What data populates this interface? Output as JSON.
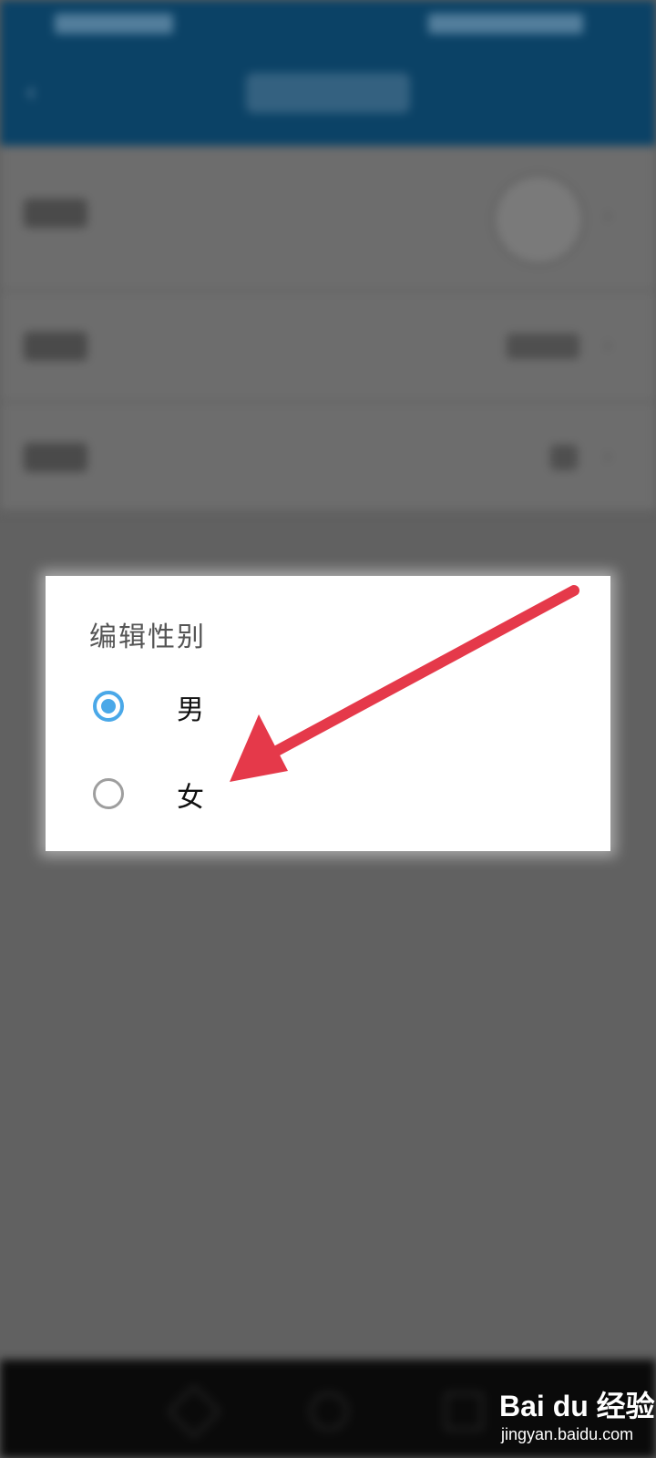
{
  "dialog": {
    "title": "编辑性别",
    "options": [
      {
        "label": "男",
        "selected": true
      },
      {
        "label": "女",
        "selected": false
      }
    ]
  },
  "colors": {
    "header": "#0b4266",
    "radio_checked": "#4aa8e8",
    "radio_unchecked": "#9e9e9e",
    "arrow": "#e5394a",
    "overlay": "#616161"
  },
  "watermark": {
    "brand": "Bai du 经验",
    "url": "jingyan.baidu.com"
  },
  "icons": {
    "back": "back-arrow-icon",
    "chevron": "chevron-right-icon"
  }
}
